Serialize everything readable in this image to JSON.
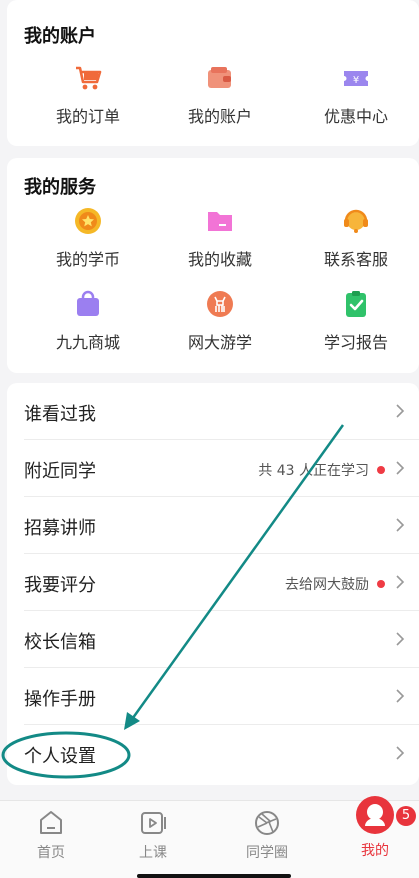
{
  "account": {
    "title": "我的账户",
    "items": [
      {
        "label": "我的订单",
        "icon": "shopping-cart-icon"
      },
      {
        "label": "我的账户",
        "icon": "wallet-icon"
      },
      {
        "label": "优惠中心",
        "icon": "coupon-icon"
      }
    ]
  },
  "services": {
    "title": "我的服务",
    "items": [
      {
        "label": "我的学币",
        "icon": "coin-icon"
      },
      {
        "label": "我的收藏",
        "icon": "folder-icon"
      },
      {
        "label": "联系客服",
        "icon": "headset-icon"
      },
      {
        "label": "九九商城",
        "icon": "shopping-bag-icon"
      },
      {
        "label": "网大游学",
        "icon": "deer-icon"
      },
      {
        "label": "学习报告",
        "icon": "report-icon"
      }
    ]
  },
  "menu": {
    "rows": [
      {
        "label": "谁看过我",
        "extra": ""
      },
      {
        "label": "附近同学",
        "extra": "共 43 人正在学习"
      },
      {
        "label": "招募讲师",
        "extra": ""
      },
      {
        "label": "我要评分",
        "extra": "去给网大鼓励"
      },
      {
        "label": "校长信箱",
        "extra": ""
      },
      {
        "label": "操作手册",
        "extra": ""
      },
      {
        "label": "个人设置",
        "extra": ""
      }
    ]
  },
  "tabbar": {
    "tabs": [
      {
        "label": "首页",
        "icon": "home-icon"
      },
      {
        "label": "上课",
        "icon": "play-icon"
      },
      {
        "label": "同学圈",
        "icon": "aperture-icon"
      },
      {
        "label": "我的",
        "icon": "profile-icon"
      }
    ],
    "badge": "5"
  },
  "colors": {
    "accent_red": "#e8343c",
    "annotation_teal": "#138a86"
  }
}
